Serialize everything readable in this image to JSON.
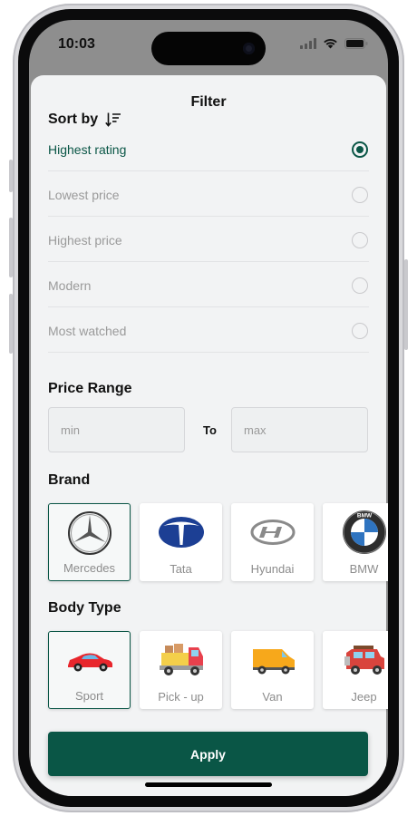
{
  "status_bar": {
    "time": "10:03"
  },
  "sheet": {
    "title": "Filter"
  },
  "sort": {
    "title": "Sort by",
    "options": [
      {
        "label": "Highest rating",
        "selected": true
      },
      {
        "label": "Lowest price",
        "selected": false
      },
      {
        "label": "Highest price",
        "selected": false
      },
      {
        "label": "Modern",
        "selected": false
      },
      {
        "label": "Most watched",
        "selected": false
      }
    ]
  },
  "price_range": {
    "title": "Price Range",
    "min_placeholder": "min",
    "to_label": "To",
    "max_placeholder": "max"
  },
  "brand": {
    "title": "Brand",
    "items": [
      {
        "label": "Mercedes",
        "icon": "mercedes-logo-icon",
        "selected": true
      },
      {
        "label": "Tata",
        "icon": "tata-logo-icon",
        "selected": false
      },
      {
        "label": "Hyundai",
        "icon": "hyundai-logo-icon",
        "selected": false
      },
      {
        "label": "BMW",
        "icon": "bmw-logo-icon",
        "selected": false
      }
    ]
  },
  "body_type": {
    "title": "Body Type",
    "items": [
      {
        "label": "Sport",
        "icon": "sport-car-icon",
        "selected": true
      },
      {
        "label": "Pick - up",
        "icon": "pickup-truck-icon",
        "selected": false
      },
      {
        "label": "Van",
        "icon": "van-icon",
        "selected": false
      },
      {
        "label": "Jeep",
        "icon": "jeep-icon",
        "selected": false
      }
    ]
  },
  "apply_label": "Apply",
  "colors": {
    "accent": "#0a5646",
    "sheet_bg": "#f2f3f4",
    "muted_text": "#9a9a9a"
  }
}
